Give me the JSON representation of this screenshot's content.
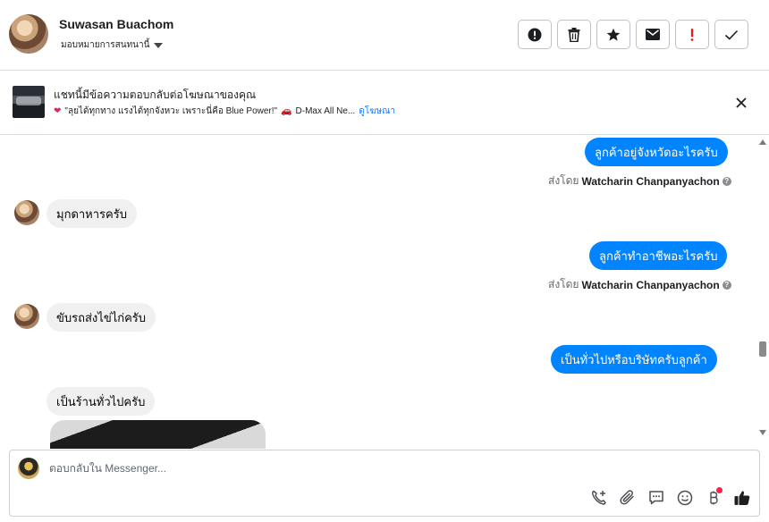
{
  "header": {
    "contact_name": "Suwasan Buachom",
    "assign_label": "มอบหมายการสนทนานี้",
    "actions": [
      {
        "name": "report-spam-button",
        "icon": "alert-circle-icon"
      },
      {
        "name": "delete-button",
        "icon": "trash-icon"
      },
      {
        "name": "star-button",
        "icon": "star-icon"
      },
      {
        "name": "mark-unread-button",
        "icon": "envelope-icon"
      },
      {
        "name": "mark-important-button",
        "icon": "exclamation-icon"
      },
      {
        "name": "mark-done-button",
        "icon": "checkmark-icon"
      }
    ]
  },
  "banner": {
    "title": "แชทนี้มีข้อความตอบกลับต่อโฆษณาของคุณ",
    "ad_text": "\"ลุยได้ทุกทาง แรงได้ทุกจังหวะ เพราะนี่คือ Blue Power!\"",
    "ad_product": "D-Max All Ne...",
    "view_ad_label": "ดูโฆษณา"
  },
  "messages": {
    "m1": "ลูกค้าอยู่จังหวัดอะไรครับ",
    "sent_by_prefix_1": "ส่งโดย",
    "sender_1": "Watcharin Chanpanyachon",
    "m2": "มุกดาหารครับ",
    "m3": "ลูกค้าทำอาชีพอะไรครับ",
    "sent_by_prefix_2": "ส่งโดย",
    "sender_2": "Watcharin Chanpanyachon",
    "m4": "ขับรถส่งไข่ไก่ครับ",
    "m5": "เป็นทั่วไปหรือบริษัทครับลูกค้า",
    "m6": "เป็นร้านทั่วไปครับ"
  },
  "composer": {
    "placeholder": "ตอบกลับใน Messenger..."
  },
  "colors": {
    "outgoing_bubble": "#0084ff",
    "incoming_bubble": "#f0f0f0",
    "link": "#1877f2",
    "important": "#e02020"
  }
}
